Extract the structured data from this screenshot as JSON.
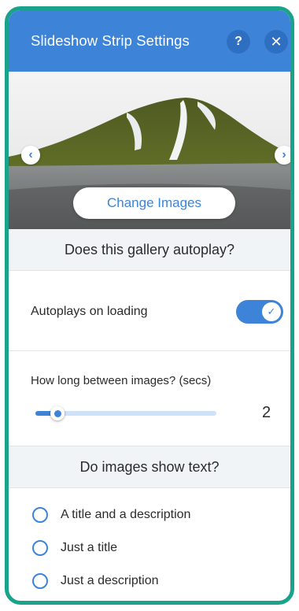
{
  "header": {
    "title": "Slideshow Strip Settings",
    "help_icon": "help-icon",
    "help_glyph": "?",
    "close_icon": "close-icon",
    "close_glyph": "✕",
    "color": "#3d84d8"
  },
  "preview": {
    "prev_glyph": "‹",
    "next_glyph": "›",
    "change_images_label": "Change Images"
  },
  "autoplay_section": {
    "title": "Does this gallery autoplay?",
    "autoplay_label": "Autoplays on loading",
    "autoplay_on": true,
    "check_glyph": "✓"
  },
  "interval": {
    "label": "How long between images? (secs)",
    "value": "2",
    "slider_fraction": 0.12
  },
  "text_section": {
    "title": "Do images show text?",
    "options": [
      "A title and a description",
      "Just a title",
      "Just a description"
    ]
  },
  "colors": {
    "accent": "#3d84d8",
    "frame": "#1aa38a"
  }
}
